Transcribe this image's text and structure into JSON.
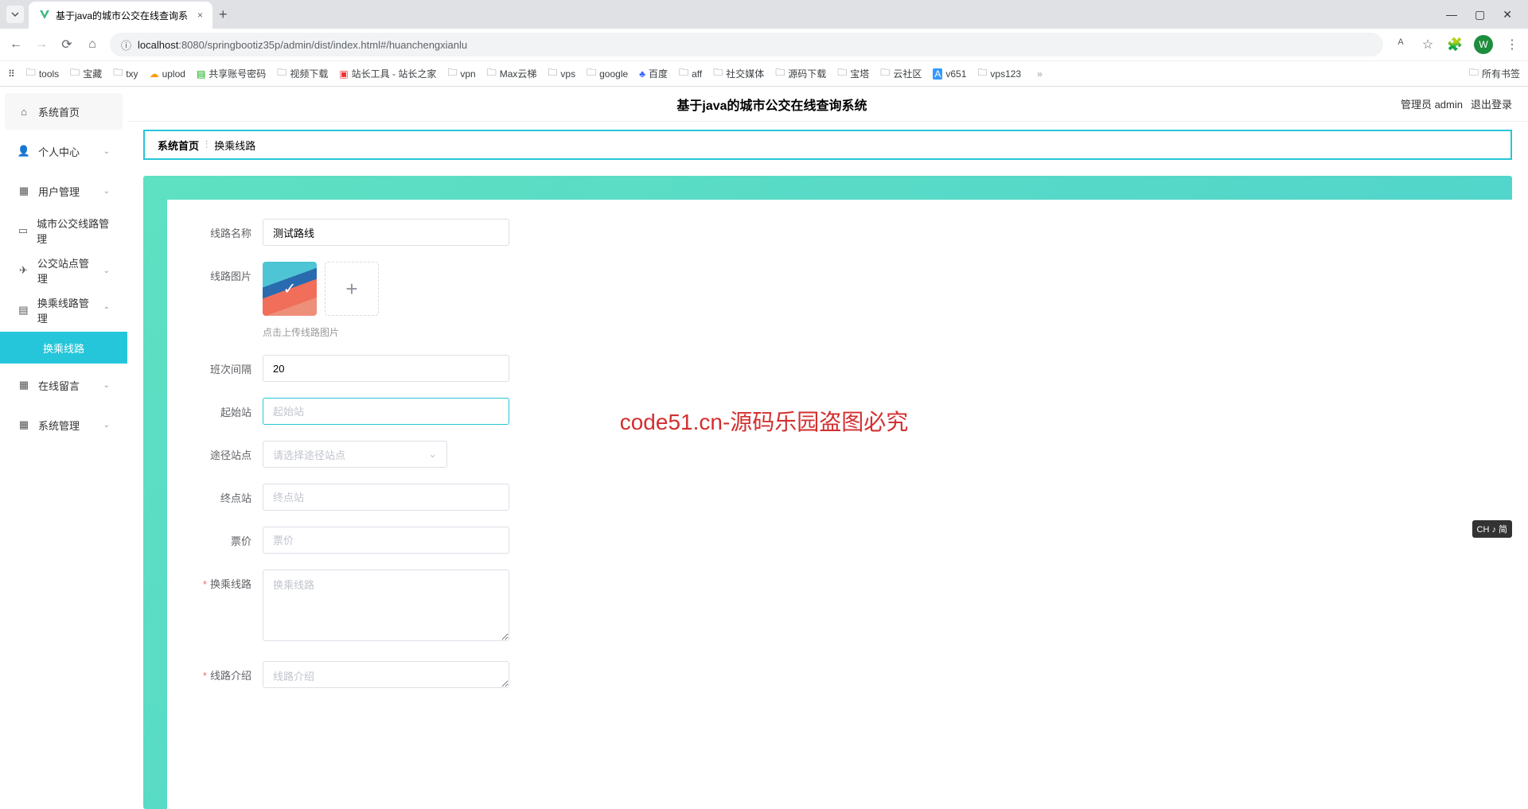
{
  "browser": {
    "tab_title": "基于java的城市公交在线查询系",
    "url_prefix": "localhost",
    "url_rest": ":8080/springbootiz35p/admin/dist/index.html#/huanchengxianlu",
    "avatar_letter": "W"
  },
  "bookmarks": [
    {
      "icon": "grid",
      "label": ""
    },
    {
      "icon": "folder",
      "label": "tools"
    },
    {
      "icon": "folder",
      "label": "宝藏"
    },
    {
      "icon": "folder",
      "label": "txy"
    },
    {
      "icon": "cloud",
      "label": "uplod"
    },
    {
      "icon": "doc",
      "label": "共享账号密码"
    },
    {
      "icon": "folder",
      "label": "视频下载"
    },
    {
      "icon": "tool",
      "label": "站长工具 - 站长之家"
    },
    {
      "icon": "folder",
      "label": "vpn"
    },
    {
      "icon": "folder",
      "label": "Max云梯"
    },
    {
      "icon": "folder",
      "label": "vps"
    },
    {
      "icon": "folder",
      "label": "google"
    },
    {
      "icon": "paw",
      "label": "百度"
    },
    {
      "icon": "folder",
      "label": "aff"
    },
    {
      "icon": "folder",
      "label": "社交媒体"
    },
    {
      "icon": "folder",
      "label": "源码下载"
    },
    {
      "icon": "folder",
      "label": "宝塔"
    },
    {
      "icon": "folder",
      "label": "云社区"
    },
    {
      "icon": "a",
      "label": "v651"
    },
    {
      "icon": "folder",
      "label": "vps123"
    }
  ],
  "bookmarks_right": "所有书签",
  "header": {
    "title": "基于java的城市公交在线查询系统",
    "user_label": "管理员 admin",
    "logout": "退出登录"
  },
  "sidebar": {
    "items": [
      {
        "icon": "home",
        "label": "系统首页",
        "chevron": false
      },
      {
        "icon": "user",
        "label": "个人中心",
        "chevron": true
      },
      {
        "icon": "grid",
        "label": "用户管理",
        "chevron": true
      },
      {
        "icon": "bus",
        "label": "城市公交线路管理",
        "chevron": false
      },
      {
        "icon": "send",
        "label": "公交站点管理",
        "chevron": true
      },
      {
        "icon": "list",
        "label": "换乘线路管理",
        "chevron": true,
        "expanded": true
      },
      {
        "icon": "grid",
        "label": "在线留言",
        "chevron": true
      },
      {
        "icon": "grid",
        "label": "系统管理",
        "chevron": true
      }
    ],
    "sub_active": "换乘线路"
  },
  "breadcrumb": {
    "home": "系统首页",
    "current": "换乘线路"
  },
  "form": {
    "route_name": {
      "label": "线路名称",
      "value": "测试路线"
    },
    "route_image": {
      "label": "线路图片",
      "hint": "点击上传线路图片"
    },
    "interval": {
      "label": "班次间隔",
      "value": "20"
    },
    "start_station": {
      "label": "起始站",
      "placeholder": "起始站",
      "value": ""
    },
    "via_stations": {
      "label": "途径站点",
      "placeholder": "请选择途径站点"
    },
    "end_station": {
      "label": "终点站",
      "placeholder": "终点站",
      "value": ""
    },
    "price": {
      "label": "票价",
      "placeholder": "票价",
      "value": ""
    },
    "transfer_route": {
      "label": "换乘线路",
      "placeholder": "换乘线路",
      "value": ""
    },
    "route_intro": {
      "label": "线路介绍",
      "placeholder": "线路介绍",
      "value": ""
    }
  },
  "watermark": "code51.cn",
  "center_warning": "code51.cn-源码乐园盗图必究",
  "ime": "CH ♪ 简"
}
